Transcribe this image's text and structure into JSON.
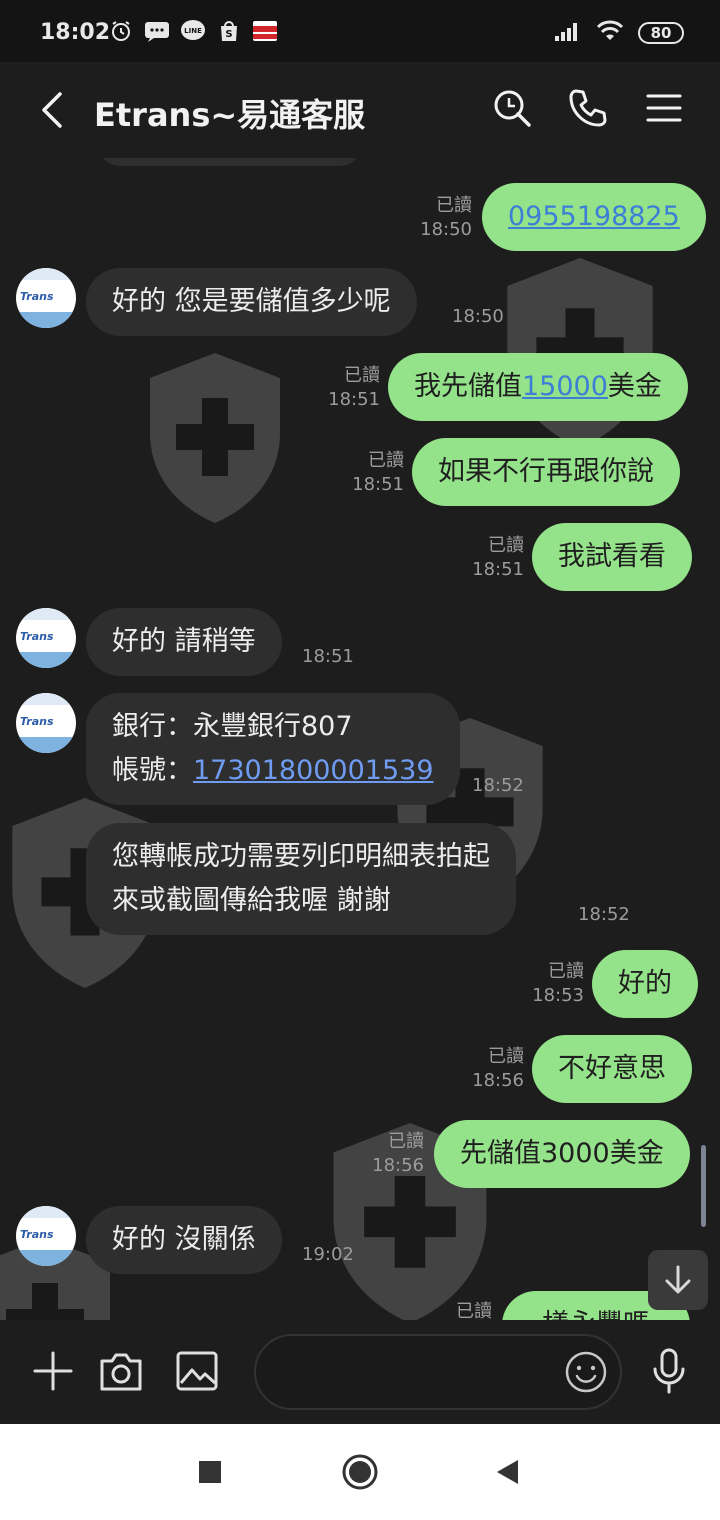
{
  "status_bar": {
    "time": "18:02",
    "battery": "80",
    "app_icons": [
      "alarm-icon",
      "sms-icon",
      "line-icon",
      "shopee-icon",
      "costco-icon"
    ]
  },
  "header": {
    "title": "Etrans~易通客服"
  },
  "messages": [
    {
      "dir": "out",
      "read": "已讀",
      "time": "18:50",
      "text": "0955198825"
    },
    {
      "dir": "in",
      "avatar": "Etrans",
      "time": "18:50",
      "text": "好的 您是要儲值多少呢"
    },
    {
      "dir": "out",
      "read": "已讀",
      "time": "18:51",
      "pre": "我先儲值",
      "link": "15000",
      "post": "美金"
    },
    {
      "dir": "out",
      "read": "已讀",
      "time": "18:51",
      "text": "如果不行再跟你說"
    },
    {
      "dir": "out",
      "read": "已讀",
      "time": "18:51",
      "text": "我試看看"
    },
    {
      "dir": "in",
      "avatar": "Etrans",
      "time": "18:51",
      "text": "好的 請稍等"
    },
    {
      "dir": "in",
      "avatar": "Etrans",
      "time": "18:52",
      "line1": "銀行：永豐銀行807",
      "line2_pre": "帳號：",
      "line2_link": "17301800001539"
    },
    {
      "dir": "in",
      "time": "18:52",
      "line1": "您轉帳成功需要列印明細表拍起",
      "line2": "來或截圖傳給我喔 謝謝"
    },
    {
      "dir": "out",
      "read": "已讀",
      "time": "18:53",
      "text": "好的"
    },
    {
      "dir": "out",
      "read": "已讀",
      "time": "18:56",
      "text": "不好意思"
    },
    {
      "dir": "out",
      "read": "已讀",
      "time": "18:56",
      "text": "先儲值3000美金"
    },
    {
      "dir": "in",
      "avatar": "Etrans",
      "time": "19:02",
      "text": "好的 沒關係"
    },
    {
      "dir": "out",
      "read": "已讀",
      "text": "樣永豐嗎"
    }
  ],
  "avatar": {
    "logo": "Trans"
  },
  "input": {
    "placeholder": ""
  },
  "colors": {
    "outgoing_bubble": "#94e289",
    "incoming_bubble": "#2e2e2e",
    "link": "#3d7fd6",
    "background": "#1d1d1d"
  }
}
